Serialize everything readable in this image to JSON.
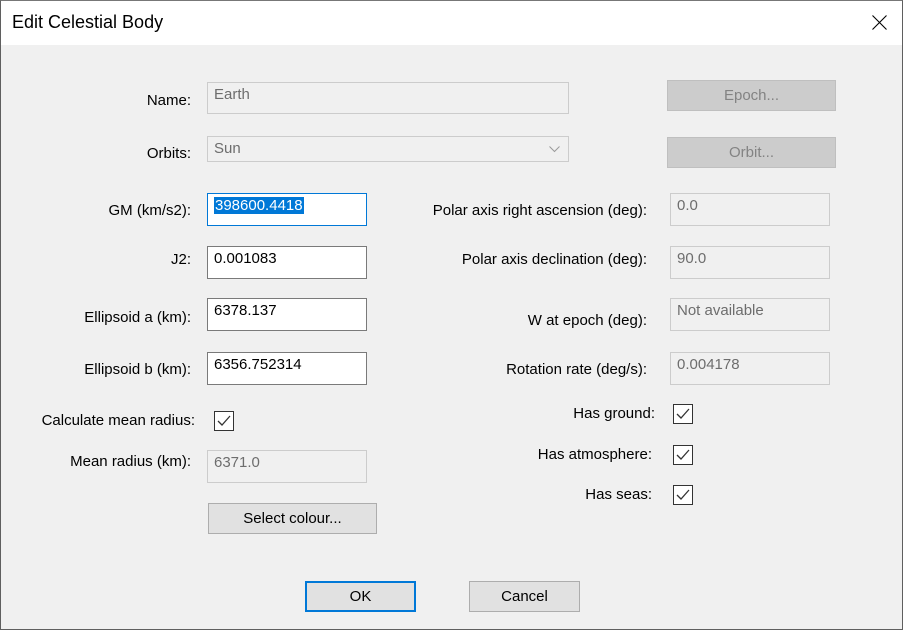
{
  "window": {
    "title": "Edit Celestial Body",
    "close_icon": "close-icon"
  },
  "form": {
    "name": {
      "label": "Name:",
      "value": "Earth",
      "enabled": false
    },
    "orbits": {
      "label": "Orbits:",
      "value": "Sun",
      "enabled": false
    },
    "gm": {
      "label": "GM (km/s2):",
      "value": "398600.4418",
      "selected": true
    },
    "j2": {
      "label": "J2:",
      "value": "0.001083"
    },
    "ellipsoid_a": {
      "label": "Ellipsoid a (km):",
      "value": "6378.137"
    },
    "ellipsoid_b": {
      "label": "Ellipsoid b (km):",
      "value": "6356.752314"
    },
    "calc_mean_radius": {
      "label": "Calculate mean radius:",
      "checked": true
    },
    "mean_radius": {
      "label": "Mean radius (km):",
      "value": "6371.0",
      "enabled": false
    },
    "polar_ra": {
      "label": "Polar axis right ascension (deg):",
      "value": "0.0",
      "enabled": false
    },
    "polar_dec": {
      "label": "Polar axis declination (deg):",
      "value": "90.0",
      "enabled": false
    },
    "w_epoch": {
      "label": "W at epoch (deg):",
      "value": "Not available",
      "enabled": false
    },
    "rotation_rate": {
      "label": "Rotation rate (deg/s):",
      "value": "0.004178",
      "enabled": false
    },
    "has_ground": {
      "label": "Has ground:",
      "checked": true
    },
    "has_atmosphere": {
      "label": "Has atmosphere:",
      "checked": true
    },
    "has_seas": {
      "label": "Has seas:",
      "checked": true
    }
  },
  "buttons": {
    "epoch": "Epoch...",
    "orbit": "Orbit...",
    "select_colour": "Select colour...",
    "ok": "OK",
    "cancel": "Cancel"
  },
  "colors": {
    "accent": "#0078d7",
    "dialog_bg": "#f0f0f0",
    "disabled_text": "#6d6d6d"
  }
}
